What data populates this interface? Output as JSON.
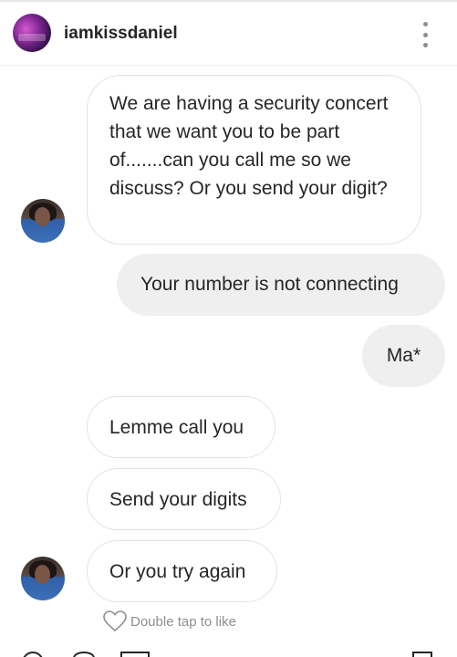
{
  "header": {
    "username": "iamkissdaniel",
    "more_icon": "more-vertical-icon"
  },
  "messages": [
    {
      "direction": "incoming",
      "text": "We are having a security concert that we want you to be part of.......can you call me so we discuss? Or you send your digit?"
    },
    {
      "direction": "outgoing",
      "text": "Your number is not connecting"
    },
    {
      "direction": "outgoing",
      "text": "Ma*"
    },
    {
      "direction": "incoming",
      "text": "Lemme call you"
    },
    {
      "direction": "incoming",
      "text": "Send your digits"
    },
    {
      "direction": "incoming",
      "text": "Or you try again"
    }
  ],
  "like_hint": {
    "icon": "heart-outline-icon",
    "label": "Double tap to like"
  },
  "colors": {
    "incoming_border": "#e3e3e3",
    "outgoing_bg": "#efefef",
    "text": "#262626",
    "muted": "#8e8e8e"
  }
}
